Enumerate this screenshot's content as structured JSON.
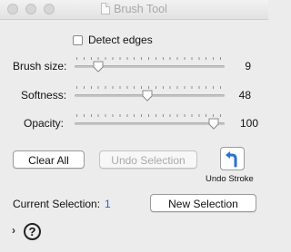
{
  "window": {
    "title": "Brush Tool"
  },
  "options": {
    "detect_edges_label": "Detect edges",
    "detect_edges_checked": false
  },
  "sliders": [
    {
      "label": "Brush size:",
      "value": "9",
      "fraction": 0.1
    },
    {
      "label": "Softness:",
      "value": "48",
      "fraction": 0.48
    },
    {
      "label": "Opacity:",
      "value": "100",
      "fraction": 1.0
    }
  ],
  "buttons": {
    "clear_all": "Clear All",
    "undo_selection": "Undo Selection",
    "undo_stroke": "Undo Stroke",
    "new_selection": "New Selection"
  },
  "selection": {
    "label": "Current Selection:",
    "value": "1"
  },
  "footer": {
    "disclosure": "›",
    "help": "?"
  },
  "colors": {
    "accent": "#2a62c9",
    "background": "#ececec"
  }
}
